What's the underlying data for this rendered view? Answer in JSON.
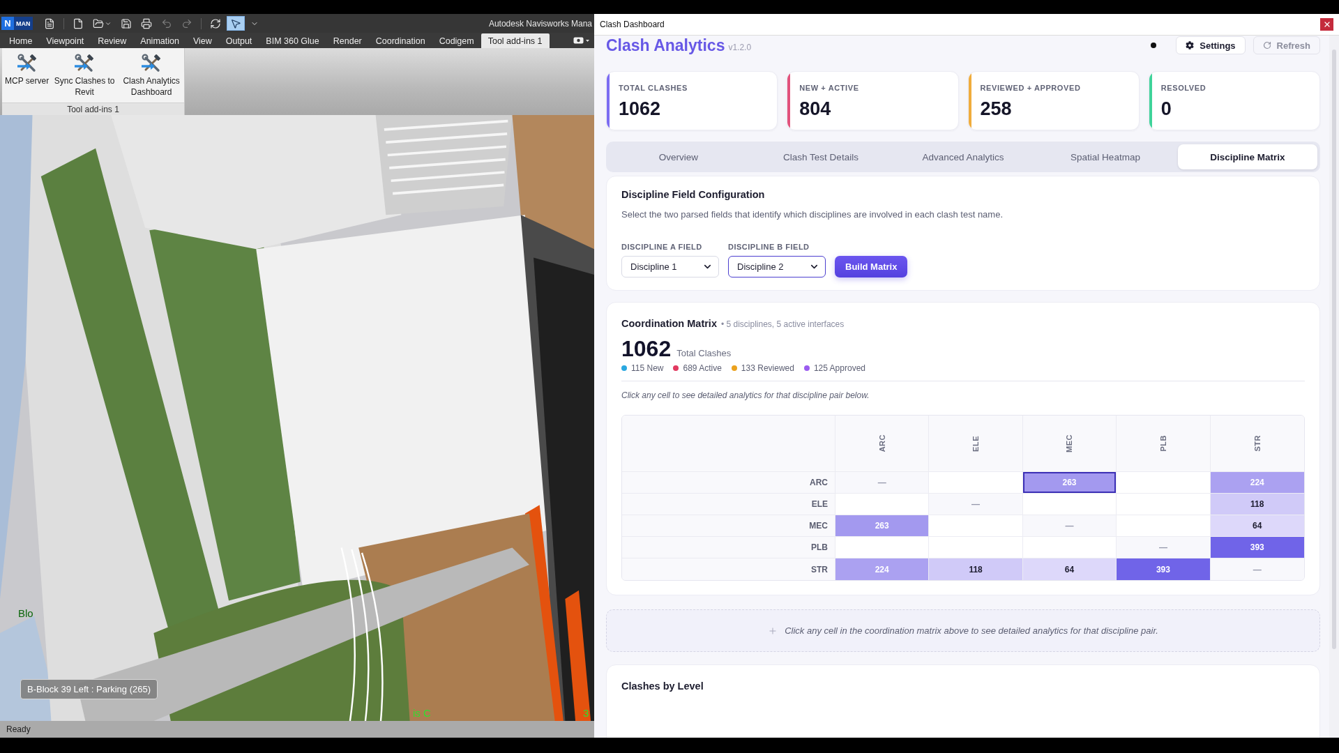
{
  "navisworks": {
    "app_logo": {
      "letter": "N",
      "badge": "MAN"
    },
    "quick_access": [
      {
        "kind": "panel",
        "pressed": false,
        "disabled": false
      },
      {
        "kind": "new",
        "pressed": false,
        "disabled": false
      },
      {
        "kind": "open",
        "pressed": false,
        "disabled": false
      },
      {
        "kind": "save",
        "pressed": false,
        "disabled": false
      },
      {
        "kind": "print",
        "pressed": false,
        "disabled": false
      },
      {
        "kind": "undo",
        "pressed": false,
        "disabled": true
      },
      {
        "kind": "redo",
        "pressed": false,
        "disabled": true
      },
      {
        "kind": "sync",
        "pressed": false,
        "disabled": false
      },
      {
        "kind": "select",
        "pressed": true,
        "disabled": false
      },
      {
        "kind": "customize",
        "pressed": false,
        "disabled": false
      }
    ],
    "title": "Autodesk Navisworks Mana",
    "ribbon_tabs": [
      {
        "label": "Home",
        "selected": false
      },
      {
        "label": "Viewpoint",
        "selected": false
      },
      {
        "label": "Review",
        "selected": false
      },
      {
        "label": "Animation",
        "selected": false
      },
      {
        "label": "View",
        "selected": false
      },
      {
        "label": "Output",
        "selected": false
      },
      {
        "label": "BIM 360 Glue",
        "selected": false
      },
      {
        "label": "Render",
        "selected": false
      },
      {
        "label": "Coordination",
        "selected": false
      },
      {
        "label": "Codigem",
        "selected": false
      },
      {
        "label": "Tool add-ins 1",
        "selected": true
      }
    ],
    "ribbon_panel": {
      "buttons": [
        {
          "label": "MCP server"
        },
        {
          "label": "Sync Clashes to Revit"
        },
        {
          "label": "Clash Analytics Dashboard"
        }
      ],
      "label": "Tool add-ins 1"
    },
    "viewport": {
      "grid_labels": [
        "Blo",
        "is C",
        "3"
      ],
      "tooltip": "B-Block 39 Left : Parking (265)"
    },
    "status_bar": {
      "text": "Ready"
    }
  },
  "dashboard": {
    "window_title": "Clash Dashboard",
    "header": {
      "title": "Clash Analytics",
      "version": "v1.2.0",
      "buttons": [
        {
          "kind": "settings",
          "label": "Settings",
          "disabled": false
        },
        {
          "kind": "refresh",
          "label": "Refresh",
          "disabled": true
        }
      ]
    },
    "stats": [
      {
        "label": "TOTAL CLASHES",
        "value": "1062",
        "color": "#7c6cf2"
      },
      {
        "label": "NEW + ACTIVE",
        "value": "804",
        "color": "#e2527c"
      },
      {
        "label": "REVIEWED + APPROVED",
        "value": "258",
        "color": "#f0ac3c"
      },
      {
        "label": "RESOLVED",
        "value": "0",
        "color": "#3fd39a"
      }
    ],
    "tabs": [
      {
        "label": "Overview",
        "selected": false
      },
      {
        "label": "Clash Test Details",
        "selected": false
      },
      {
        "label": "Advanced Analytics",
        "selected": false
      },
      {
        "label": "Spatial Heatmap",
        "selected": false
      },
      {
        "label": "Discipline Matrix",
        "selected": true
      }
    ],
    "field_config": {
      "title": "Discipline Field Configuration",
      "description": "Select the two parsed fields that identify which disciplines are involved in each clash test name.",
      "fields": [
        {
          "label": "DISCIPLINE A FIELD",
          "value": "Discipline 1",
          "focused": false
        },
        {
          "label": "DISCIPLINE B FIELD",
          "value": "Discipline 2",
          "focused": true
        }
      ],
      "button": "Build Matrix"
    },
    "matrix": {
      "title": "Coordination Matrix",
      "subtitle": "• 5 disciplines, 5 active interfaces",
      "total": "1062",
      "total_label": "Total Clashes",
      "legend": [
        {
          "label": "115 New",
          "color": "#2aa8e0"
        },
        {
          "label": "689 Active",
          "color": "#e23a60"
        },
        {
          "label": "133 Reviewed",
          "color": "#eba21e"
        },
        {
          "label": "125 Approved",
          "color": "#9b5cf0"
        }
      ],
      "hint": "Click any cell to see detailed analytics for that discipline pair below.",
      "columns": [
        "ARC",
        "ELE",
        "MEC",
        "PLB",
        "STR"
      ],
      "rows": [
        {
          "label": "ARC",
          "cells": [
            {
              "kind": "diagonal",
              "value": "—",
              "hovered": false
            },
            {
              "kind": "empty",
              "hovered": false
            },
            {
              "kind": "count",
              "value": "263",
              "color": "#a399ef",
              "hovered": true
            },
            {
              "kind": "empty",
              "hovered": false
            },
            {
              "kind": "count",
              "value": "224",
              "color": "#aba1f1",
              "hovered": false
            }
          ]
        },
        {
          "label": "ELE",
          "cells": [
            {
              "kind": "empty",
              "hovered": false
            },
            {
              "kind": "diagonal",
              "value": "—",
              "hovered": false
            },
            {
              "kind": "empty",
              "hovered": false
            },
            {
              "kind": "empty",
              "hovered": false
            },
            {
              "kind": "count",
              "value": "118",
              "color": "#d0caf8",
              "hovered": false
            }
          ]
        },
        {
          "label": "MEC",
          "cells": [
            {
              "kind": "count",
              "value": "263",
              "color": "#a399ef",
              "hovered": false
            },
            {
              "kind": "empty",
              "hovered": false
            },
            {
              "kind": "diagonal",
              "value": "—",
              "hovered": false
            },
            {
              "kind": "empty",
              "hovered": false
            },
            {
              "kind": "count",
              "value": "64",
              "color": "#ddd8fa",
              "hovered": false
            }
          ]
        },
        {
          "label": "PLB",
          "cells": [
            {
              "kind": "empty",
              "hovered": false
            },
            {
              "kind": "empty",
              "hovered": false
            },
            {
              "kind": "empty",
              "hovered": false
            },
            {
              "kind": "diagonal",
              "value": "—",
              "hovered": false
            },
            {
              "kind": "count",
              "value": "393",
              "color": "#7064e8",
              "hovered": false
            }
          ]
        },
        {
          "label": "STR",
          "cells": [
            {
              "kind": "count",
              "value": "224",
              "color": "#aba1f1",
              "hovered": false
            },
            {
              "kind": "count",
              "value": "118",
              "color": "#d0caf8",
              "hovered": false
            },
            {
              "kind": "count",
              "value": "64",
              "color": "#ddd8fa",
              "hovered": false
            },
            {
              "kind": "count",
              "value": "393",
              "color": "#7064e8",
              "hovered": false
            },
            {
              "kind": "diagonal",
              "value": "—",
              "hovered": false
            }
          ]
        }
      ]
    },
    "placeholder_box": {
      "text": "Click any cell in the coordination matrix above to see detailed analytics for that discipline pair."
    },
    "level_section": {
      "title": "Clashes by Level"
    }
  }
}
